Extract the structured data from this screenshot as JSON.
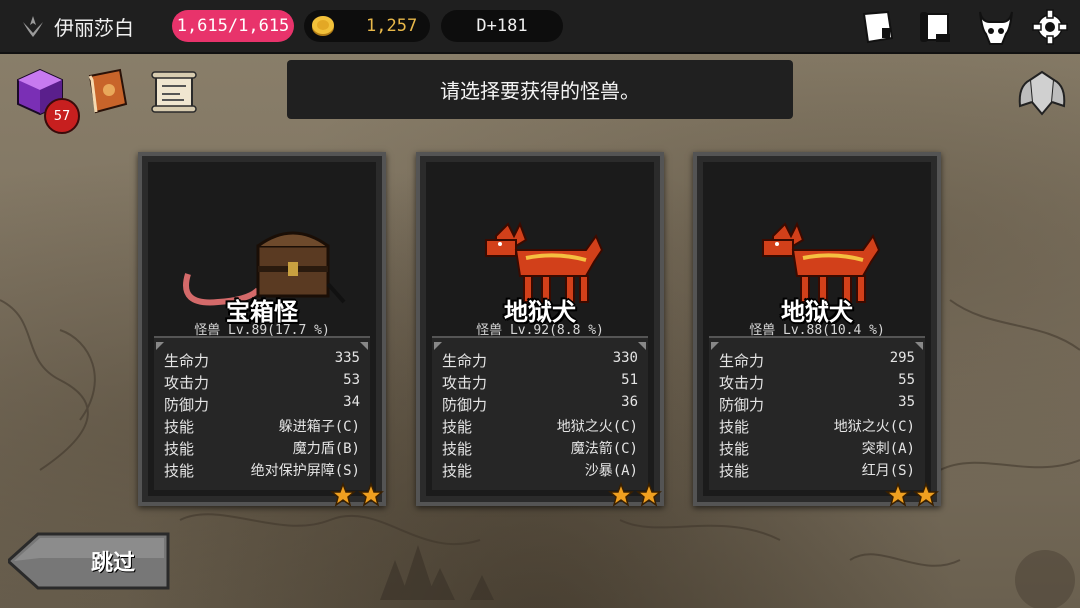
{
  "header": {
    "player_name": "伊丽莎白",
    "hp": "1,615/1,615",
    "gold": "1,257",
    "day": "D+181"
  },
  "inventory": {
    "cube_count": "57"
  },
  "banner": {
    "text": "请选择要获得的怪兽。"
  },
  "cards": [
    {
      "name": "宝箱怪",
      "subtitle": "怪兽 Lv.89(17.7 %)",
      "stats": [
        {
          "label": "生命力",
          "value": "335"
        },
        {
          "label": "攻击力",
          "value": "53"
        },
        {
          "label": "防御力",
          "value": "34"
        },
        {
          "label": "技能",
          "value": "躲进箱子(C)"
        },
        {
          "label": "技能",
          "value": "魔力盾(B)"
        },
        {
          "label": "技能",
          "value": "绝对保护屏障(S)"
        }
      ],
      "stars": 2
    },
    {
      "name": "地狱犬",
      "subtitle": "怪兽 Lv.92(8.8 %)",
      "stats": [
        {
          "label": "生命力",
          "value": "330"
        },
        {
          "label": "攻击力",
          "value": "51"
        },
        {
          "label": "防御力",
          "value": "36"
        },
        {
          "label": "技能",
          "value": "地狱之火(C)"
        },
        {
          "label": "技能",
          "value": "魔法箭(C)"
        },
        {
          "label": "技能",
          "value": "沙暴(A)"
        }
      ],
      "stars": 2
    },
    {
      "name": "地狱犬",
      "subtitle": "怪兽 Lv.88(10.4 %)",
      "stats": [
        {
          "label": "生命力",
          "value": "295"
        },
        {
          "label": "攻击力",
          "value": "55"
        },
        {
          "label": "防御力",
          "value": "35"
        },
        {
          "label": "技能",
          "value": "地狱之火(C)"
        },
        {
          "label": "技能",
          "value": "突刺(A)"
        },
        {
          "label": "技能",
          "value": "红月(S)"
        }
      ],
      "stars": 2
    }
  ],
  "skip_label": "跳过",
  "colors": {
    "hp_pill": "#e8336b",
    "gold_text": "#e8b84a",
    "card_border": "#545454",
    "star": "#f0a020"
  },
  "icons": {
    "header_left": "guild-emblem-icon",
    "coin": "gold-coin-icon",
    "top_right": [
      "journal-icon",
      "scroll-icon",
      "demon-skull-icon",
      "settings-gear-icon"
    ],
    "items": [
      "purple-cube-icon",
      "spellbook-icon",
      "map-scroll-icon"
    ],
    "side": "winged-shield-icon",
    "rating": "star-icon"
  }
}
